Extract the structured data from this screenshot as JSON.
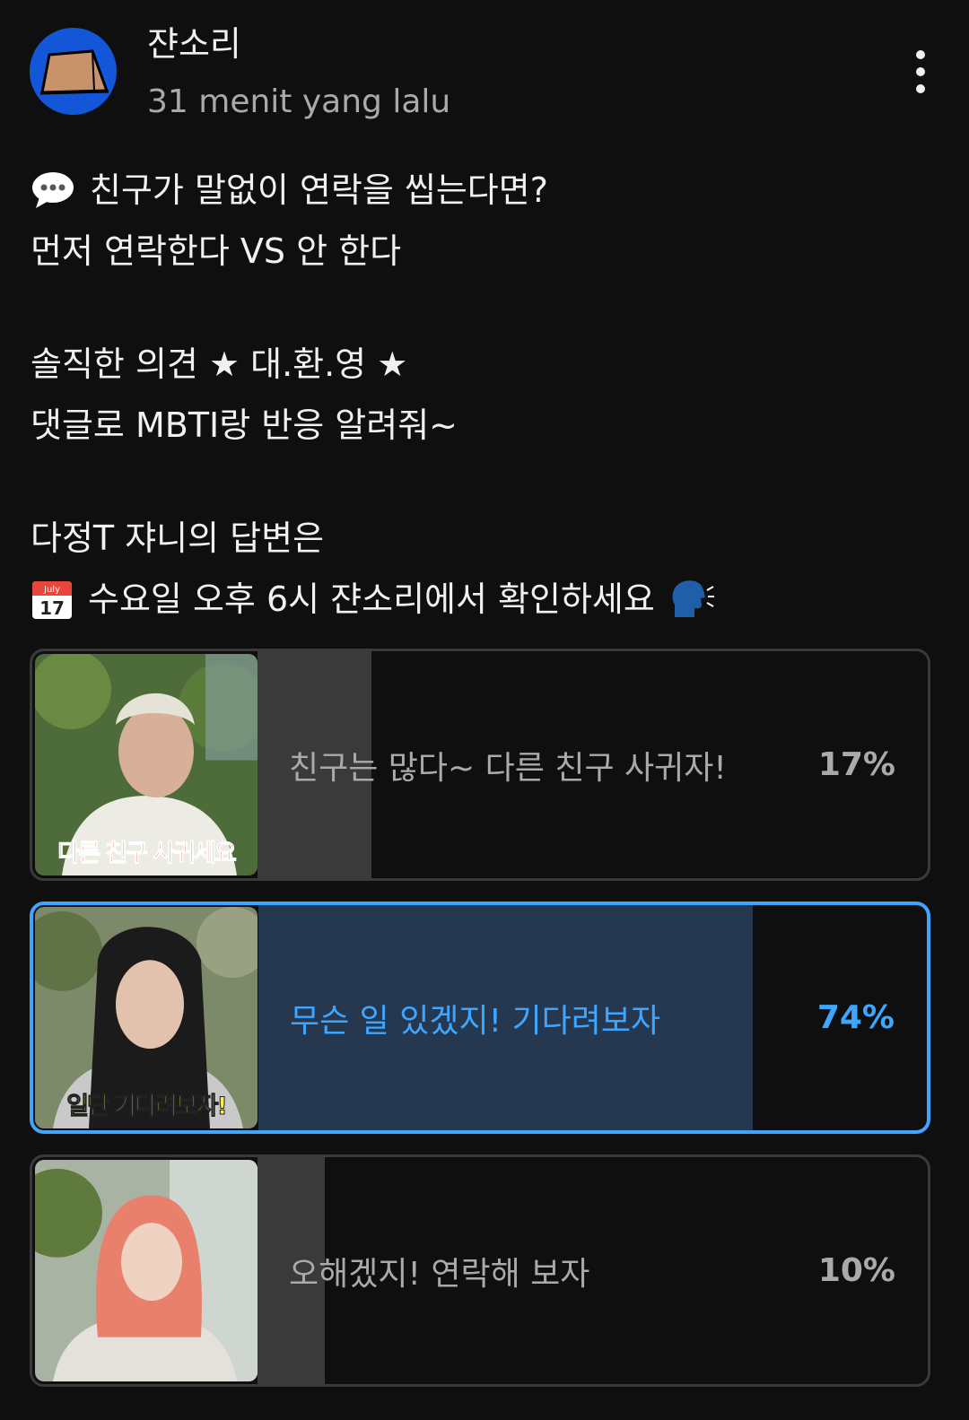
{
  "post": {
    "channel_name": "쟌소리",
    "timestamp": "31 menit yang lalu",
    "menu_icon": "more-vertical-icon",
    "avatar_icon": "folded-card-icon",
    "text": {
      "line1": "친구가 말없이 연락을 씹는다면?",
      "line2": "먼저 연락한다 VS 안 한다",
      "line3": "솔직한 의견 ★ 대.환.영 ★",
      "line4": "댓글로 MBTI랑 반응 알려줘~",
      "line5": "다정T 쟈니의 답변은",
      "line6": "수요일 오후 6시 쟌소리에서 확인하세요",
      "emoji_speech": "speech-balloon-icon",
      "emoji_calendar": "calendar-icon",
      "calendar_month": "July",
      "calendar_day": "17",
      "emoji_speaking_head": "speaking-head-icon"
    }
  },
  "poll": {
    "accent_color": "#3ea6ff",
    "options": [
      {
        "label": "친구는 많다~ 다른 친구 사귀자!",
        "percent": "17%",
        "fraction": 0.17,
        "selected": false,
        "thumb_caption": "다른 친구 사귀세요"
      },
      {
        "label": "무슨 일 있겠지! 기다려보자",
        "percent": "74%",
        "fraction": 0.74,
        "selected": true,
        "thumb_caption": "일단 기다려보자!"
      },
      {
        "label": "오해겠지! 연락해 보자",
        "percent": "10%",
        "fraction": 0.1,
        "selected": false,
        "thumb_caption": ""
      }
    ]
  }
}
